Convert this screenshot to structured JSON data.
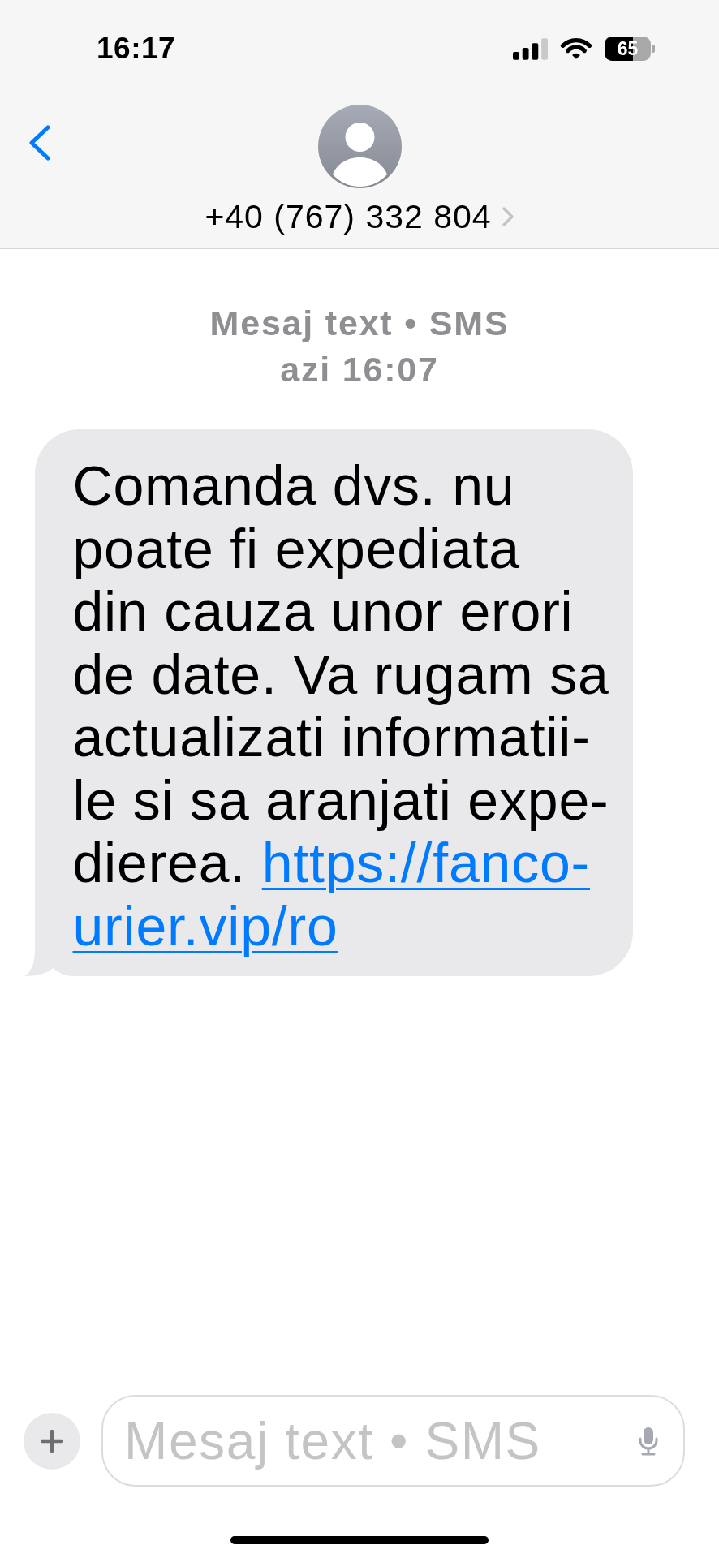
{
  "status_bar": {
    "time": "16:17",
    "battery": "65"
  },
  "header": {
    "contact": "+40 (767) 332 804"
  },
  "conversation": {
    "service": "Mesaj text • SMS",
    "timestamp": "azi 16:07",
    "messages": [
      {
        "kind": "incoming",
        "lines": [
          "Comanda dvs. nu",
          "poate fi expediata",
          "din cauza unor erori",
          "de date. Va rugam sa",
          "actualizati informatii-",
          "le si sa aranjati expe-",
          "dierea."
        ],
        "link": [
          "https://fanco-",
          "urier.vip/ro"
        ]
      }
    ]
  },
  "composer": {
    "placeholder": "Mesaj text • SMS"
  }
}
